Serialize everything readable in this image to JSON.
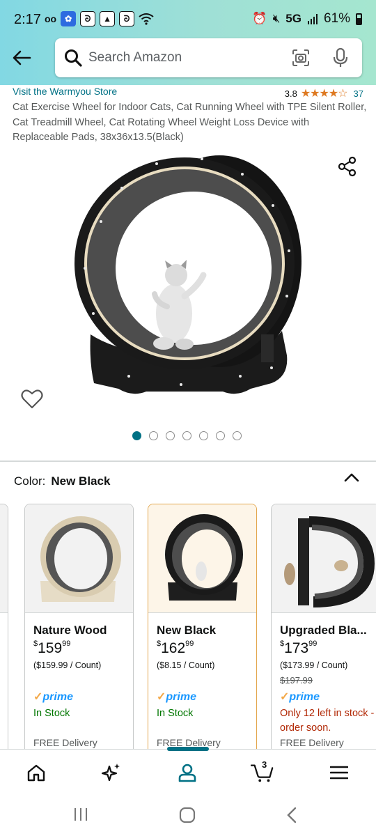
{
  "status_bar": {
    "time": "2:17",
    "network": "5G",
    "battery": "61%"
  },
  "search": {
    "placeholder": "Search Amazon"
  },
  "product": {
    "store_link": "Visit the Warmyou Store",
    "rating": "3.8",
    "rating_value": 3.8,
    "stars": "★★★★☆",
    "review_count": "37",
    "title": "Cat Exercise Wheel for Indoor Cats, Cat Running Wheel with TPE Silent Roller, Cat Treadmill Wheel, Cat Rotating Wheel Weight Loss Device with Replaceable Pads, 38x36x13.5(Black)",
    "image_count": 7,
    "active_image": 1
  },
  "variation": {
    "label": "Color:",
    "selected": "New Black"
  },
  "options": [
    {
      "name": "Nature Wood",
      "price_whole": "159",
      "price_frac": "99",
      "unit_price": "($159.99 / Count)",
      "list_price": "",
      "prime": "prime",
      "stock": "In Stock",
      "delivery": "FREE Delivery"
    },
    {
      "name": "New Black",
      "price_whole": "162",
      "price_frac": "99",
      "unit_price": "($8.15 / Count)",
      "list_price": "",
      "prime": "prime",
      "stock": "In Stock",
      "delivery": "FREE Delivery"
    },
    {
      "name": "Upgraded Bla...",
      "price_whole": "173",
      "price_frac": "99",
      "unit_price": "($173.99 / Count)",
      "list_price": "$197.99",
      "prime": "prime",
      "stock": "Only 12 left in stock - order soon.",
      "delivery": "FREE Delivery"
    }
  ],
  "currency_symbol": "$",
  "bottom_nav": {
    "cart_count": "3"
  },
  "colors": {
    "link": "#007185",
    "star": "#de7921",
    "in_stock": "#007600",
    "low_stock": "#b12704",
    "prime": "#1a98ff"
  }
}
